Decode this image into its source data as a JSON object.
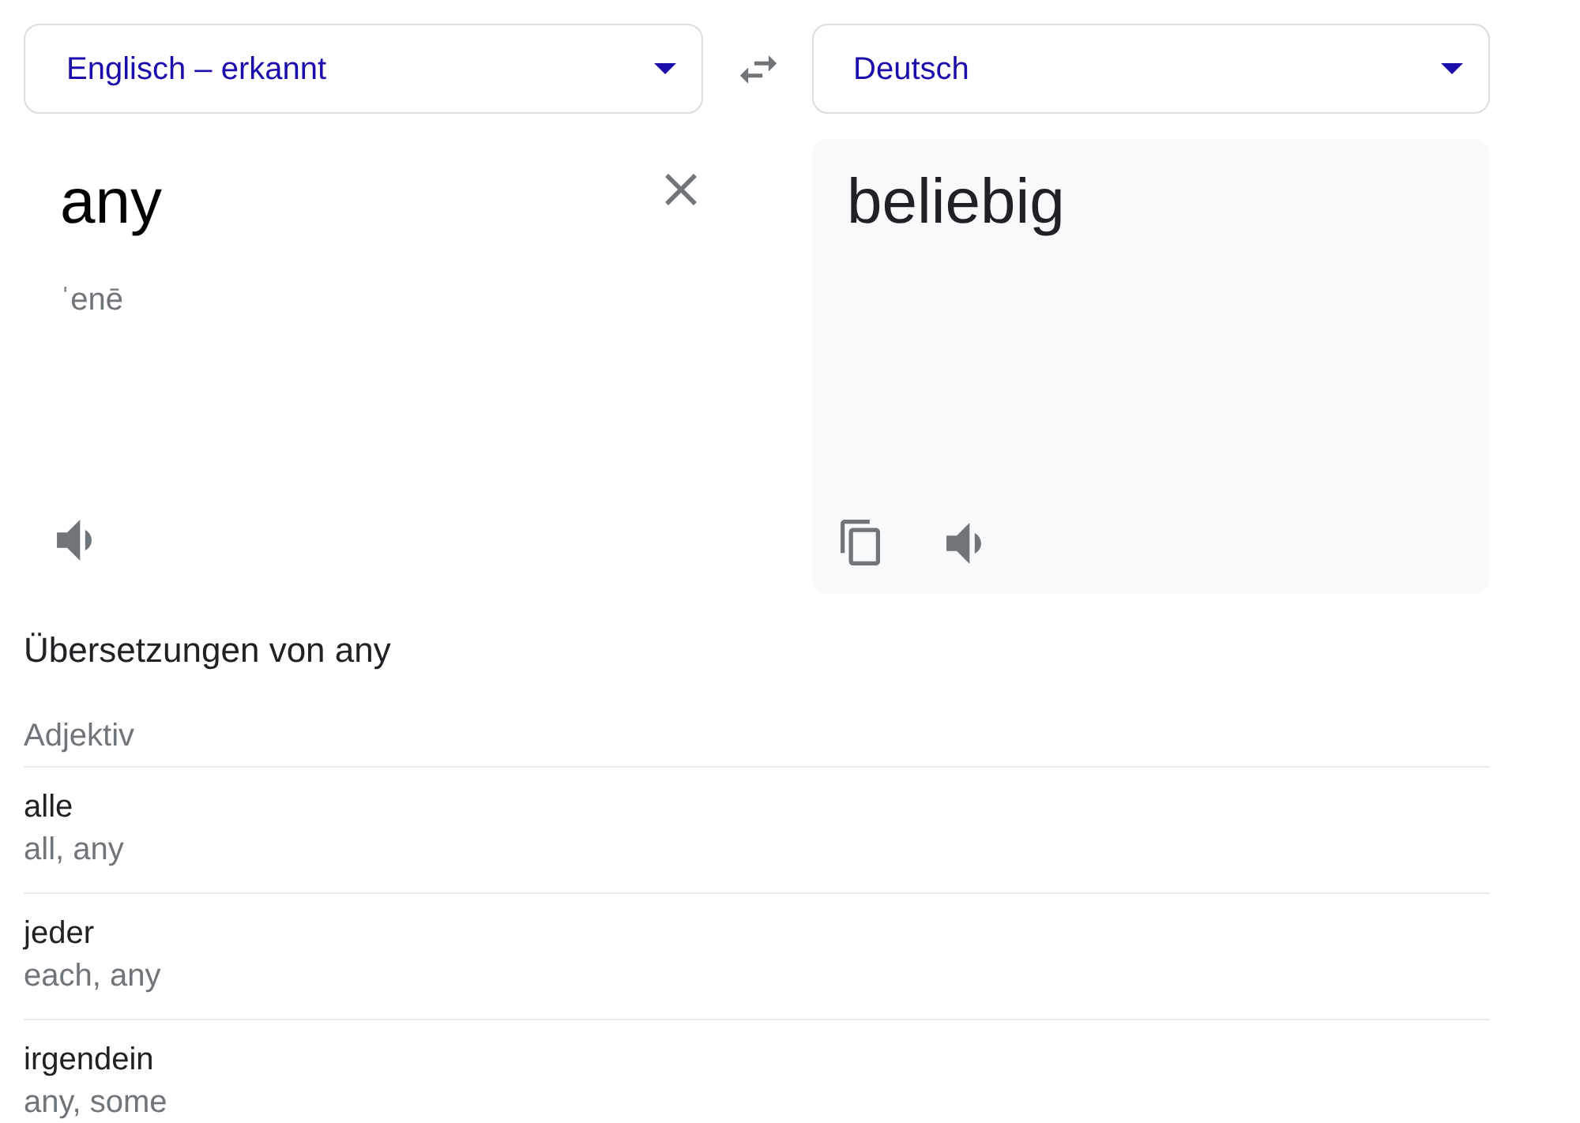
{
  "source_language": {
    "label": "Englisch – erkannt"
  },
  "target_language": {
    "label": "Deutsch"
  },
  "source": {
    "text": "any",
    "pronunciation": "ˈenē"
  },
  "target": {
    "text": "beliebig"
  },
  "translations": {
    "title": "Übersetzungen von any",
    "groups": [
      {
        "part_of_speech": "Adjektiv",
        "entries": [
          {
            "word": "alle",
            "back_translations": "all, any"
          },
          {
            "word": "jeder",
            "back_translations": "each, any"
          },
          {
            "word": "irgendein",
            "back_translations": "any, some"
          }
        ]
      }
    ]
  }
}
